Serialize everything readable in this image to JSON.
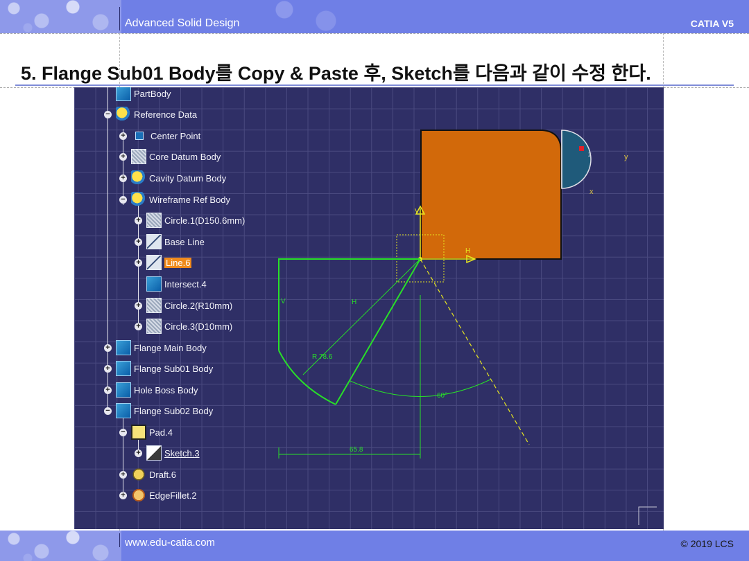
{
  "header": {
    "left_title": "Advanced Solid Design",
    "right_title": "CATIA V5"
  },
  "footer": {
    "website": "www.edu-catia.com",
    "copyright": "© 2019 LCS"
  },
  "slide": {
    "heading": "5. Flange Sub01 Body를 Copy & Paste 후, Sketch를 다음과 같이 수정 한다."
  },
  "colors": {
    "band": "#6f7fe6",
    "canvas_bg": "#2f2f66",
    "grid": "#4a4a80",
    "sketch_green": "#28e028",
    "solid_orange": "#d2690a",
    "selection_orange": "#f08a1c",
    "axis_yellow": "#e6e620"
  },
  "tree": {
    "items": [
      {
        "label": "PartBody",
        "icon": "body-icon"
      },
      {
        "label": "Reference Data",
        "icon": "body-icon"
      },
      {
        "label": "Center Point",
        "icon": "point-icon"
      },
      {
        "label": "Core Datum Body",
        "icon": "geometrical-set-icon"
      },
      {
        "label": "Cavity Datum Body",
        "icon": "geometrical-set-icon"
      },
      {
        "label": "Wireframe Ref Body",
        "icon": "geometrical-set-icon"
      },
      {
        "label": "Circle.1(D150.6mm)",
        "icon": "circle-icon"
      },
      {
        "label": "Base Line",
        "icon": "line-icon"
      },
      {
        "label": "Line.6",
        "icon": "line-icon",
        "selected": true
      },
      {
        "label": "Intersect.4",
        "icon": "intersect-icon"
      },
      {
        "label": "Circle.2(R10mm)",
        "icon": "circle-icon"
      },
      {
        "label": "Circle.3(D10mm)",
        "icon": "circle-icon"
      },
      {
        "label": "Flange Main Body",
        "icon": "body-icon"
      },
      {
        "label": "Flange Sub01 Body",
        "icon": "body-icon"
      },
      {
        "label": "Hole Boss Body",
        "icon": "body-icon"
      },
      {
        "label": "Flange Sub02 Body",
        "icon": "body-icon"
      },
      {
        "label": "Pad.4",
        "icon": "pad-icon"
      },
      {
        "label": "Sketch.3",
        "icon": "sketch-icon",
        "underlined": true
      },
      {
        "label": "Draft.6",
        "icon": "draft-icon"
      },
      {
        "label": "EdgeFillet.2",
        "icon": "edge-fillet-icon"
      }
    ]
  },
  "sketch": {
    "dimensions": {
      "radius": "R 78.6",
      "angle": "60°",
      "width": "65.8"
    },
    "axis_labels": {
      "h": "H",
      "v": "V",
      "h2": "H",
      "v2": "V"
    },
    "compass": {
      "z": "z",
      "y": "y",
      "x": "x"
    }
  }
}
